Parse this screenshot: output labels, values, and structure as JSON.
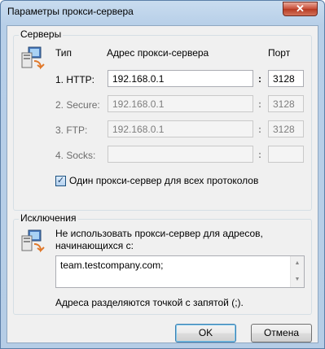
{
  "window": {
    "title": "Параметры прокси-сервера",
    "close_glyph": "✕"
  },
  "servers": {
    "legend": "Серверы",
    "col_type": "Тип",
    "col_address": "Адрес прокси-сервера",
    "col_port": "Порт",
    "rows": [
      {
        "label": "1. HTTP:",
        "address": "192.168.0.1",
        "port": "3128",
        "enabled": true
      },
      {
        "label": "2. Secure:",
        "address": "192.168.0.1",
        "port": "3128",
        "enabled": false
      },
      {
        "label": "3. FTP:",
        "address": "192.168.0.1",
        "port": "3128",
        "enabled": false
      },
      {
        "label": "4. Socks:",
        "address": "",
        "port": "",
        "enabled": false
      }
    ],
    "colon": ":",
    "same_proxy_label": "Один прокси-сервер для всех протоколов",
    "same_proxy_checked": true
  },
  "exceptions": {
    "legend": "Исключения",
    "desc": "Не использовать прокси-сервер для адресов, начинающихся с:",
    "value": "team.testcompany.com;",
    "hint": "Адреса разделяются точкой с запятой (;)."
  },
  "buttons": {
    "ok": "OK",
    "cancel": "Отмена"
  },
  "icons": {
    "servers": "network-computer-icon",
    "exceptions": "network-computer-icon"
  }
}
